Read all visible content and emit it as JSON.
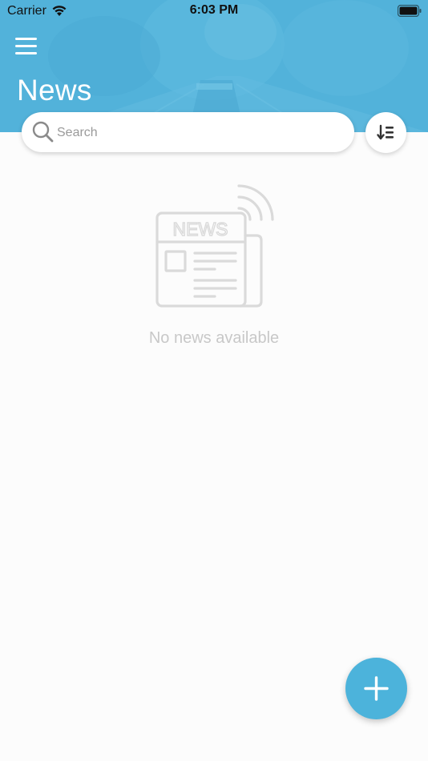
{
  "status_bar": {
    "carrier": "Carrier",
    "time": "6:03 PM"
  },
  "header": {
    "title": "News",
    "menu_icon": "hamburger-menu-icon"
  },
  "search": {
    "placeholder": "Search",
    "value": "",
    "icon": "search-icon"
  },
  "sort_button": {
    "icon": "sort-descending-icon"
  },
  "empty_state": {
    "illustration": {
      "icon": "newspaper-broadcast-icon",
      "label": "NEWS"
    },
    "message": "No news available"
  },
  "fab": {
    "icon": "plus-icon"
  },
  "colors": {
    "accent": "#4cb3db",
    "header_tint": "#56b3d9",
    "background": "#fcfcfc",
    "empty_gray": "#c8c8c8"
  }
}
